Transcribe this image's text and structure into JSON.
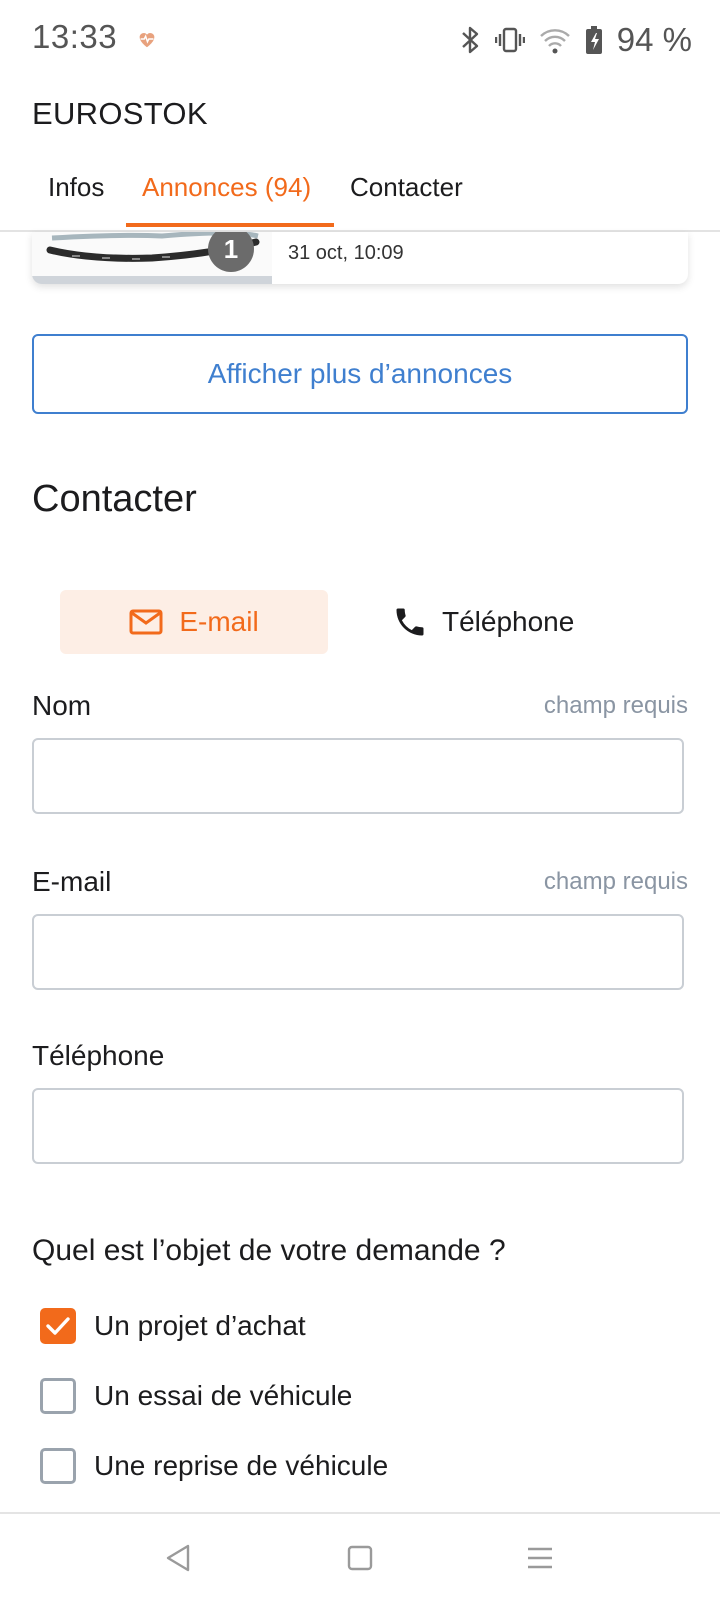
{
  "status_bar": {
    "time": "13:33",
    "battery": "94 %",
    "icons": [
      "heart-monitor-icon",
      "bluetooth-icon",
      "vibrate-icon",
      "wifi-icon",
      "battery-icon"
    ]
  },
  "app_bar": {
    "title": "EUROSTOK",
    "tabs": [
      {
        "label": "Infos",
        "active": false
      },
      {
        "label": "Annonces (94)",
        "active": true
      },
      {
        "label": "Contacter",
        "active": false
      }
    ]
  },
  "listing": {
    "photo_count": "1",
    "date": "31 oct, 10:09"
  },
  "show_more_label": "Afficher plus d’annonces",
  "contact": {
    "title": "Contacter",
    "mode_options": [
      {
        "label": "E-mail",
        "icon": "mail-icon",
        "selected": true
      },
      {
        "label": "Téléphone",
        "icon": "phone-icon",
        "selected": false
      }
    ],
    "fields": [
      {
        "label": "Nom",
        "required_text": "champ requis",
        "value": ""
      },
      {
        "label": "E-mail",
        "required_text": "champ requis",
        "value": ""
      },
      {
        "label": "Téléphone",
        "required_text": "",
        "value": ""
      }
    ],
    "question": "Quel est l’objet de votre demande ?",
    "options": [
      {
        "label": "Un projet d’achat",
        "checked": true
      },
      {
        "label": "Un essai de véhicule",
        "checked": false
      },
      {
        "label": "Une reprise de véhicule",
        "checked": false
      }
    ]
  },
  "colors": {
    "accent": "#f26a1b",
    "link": "#3f7fcf",
    "muted": "#8a95a3"
  }
}
